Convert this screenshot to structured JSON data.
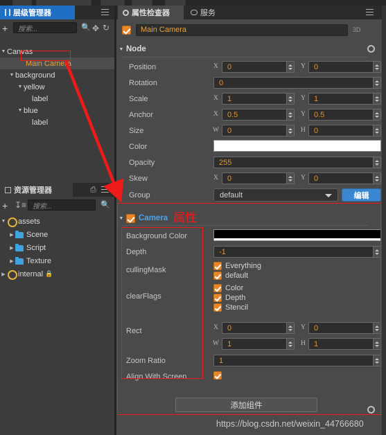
{
  "window": {
    "bg_color": "#2b2b2b",
    "accent_orange": "#e8912a",
    "accent_blue": "#3a87cf",
    "annotation_red": "#ee1b1b"
  },
  "hierarchy_panel": {
    "tab_label": "层级管理器",
    "tab_icon": "hierarchy-icon",
    "menu_icon": "hamburger-icon",
    "toolbar": {
      "add_icon": "plus-icon",
      "search_placeholder": "搜索...",
      "search_value": "",
      "icons": [
        "search-icon",
        "locate-icon",
        "refresh-icon"
      ]
    },
    "tree": [
      {
        "label": "Canvas",
        "depth": 1,
        "caret": "down",
        "selected": false,
        "color": "white"
      },
      {
        "label": "Main Camera",
        "depth": 2,
        "caret": "none",
        "selected": true,
        "color": "sel"
      },
      {
        "label": "background",
        "depth": 2,
        "caret": "down",
        "selected": false,
        "color": "white"
      },
      {
        "label": "yellow",
        "depth": 3,
        "caret": "down",
        "selected": false,
        "color": "white"
      },
      {
        "label": "label",
        "depth": 4,
        "caret": "none",
        "selected": false,
        "color": "white"
      },
      {
        "label": "blue",
        "depth": 3,
        "caret": "down",
        "selected": false,
        "color": "white"
      },
      {
        "label": "label",
        "depth": 4,
        "caret": "none",
        "selected": false,
        "color": "white"
      }
    ]
  },
  "assets_panel": {
    "tab_label": "资源管理器",
    "tab_icon": "assets-icon",
    "refresh_icon": "refresh-icon",
    "menu_icon": "hamburger-icon",
    "toolbar": {
      "add_icon": "plus-icon",
      "sort_icon": "sort-icon",
      "search_placeholder": "搜索...",
      "search_value": "",
      "search_icon": "search-icon"
    },
    "tree": [
      {
        "label": "assets",
        "depth": 1,
        "caret": "down",
        "icon": "database-icon",
        "locked": false,
        "color": "white"
      },
      {
        "label": "Scene",
        "depth": 2,
        "caret": "right",
        "icon": "folder-icon",
        "locked": false,
        "color": "white"
      },
      {
        "label": "Script",
        "depth": 2,
        "caret": "right",
        "icon": "folder-icon",
        "locked": false,
        "color": "white"
      },
      {
        "label": "Texture",
        "depth": 2,
        "caret": "right",
        "icon": "folder-icon",
        "locked": false,
        "color": "white"
      },
      {
        "label": "internal",
        "depth": 1,
        "caret": "right",
        "icon": "database-icon",
        "locked": true,
        "color": "white"
      }
    ]
  },
  "inspector": {
    "tabs": [
      {
        "label": "属性检查器",
        "icon": "gear-icon",
        "active": true
      },
      {
        "label": "服务",
        "icon": "cloud-icon",
        "active": false
      }
    ],
    "menu_icon": "hamburger-icon",
    "node_name": "Main Camera",
    "node_enabled": true,
    "mode_badge": "3D",
    "node_section": {
      "title": "Node",
      "expanded": true,
      "settings_icon": "gear-icon",
      "rows": [
        {
          "label": "Position",
          "kind": "xy",
          "x_axis": "X",
          "x": "0",
          "y_axis": "Y",
          "y": "0"
        },
        {
          "label": "Rotation",
          "kind": "single",
          "value": "0"
        },
        {
          "label": "Scale",
          "kind": "xy",
          "x_axis": "X",
          "x": "1",
          "y_axis": "Y",
          "y": "1"
        },
        {
          "label": "Anchor",
          "kind": "xy",
          "x_axis": "X",
          "x": "0.5",
          "y_axis": "Y",
          "y": "0.5"
        },
        {
          "label": "Size",
          "kind": "xy",
          "x_axis": "W",
          "x": "0",
          "y_axis": "H",
          "y": "0"
        },
        {
          "label": "Color",
          "kind": "color",
          "color": "#ffffff",
          "alpha_color": "#ffffff"
        },
        {
          "label": "Opacity",
          "kind": "single",
          "value": "255"
        },
        {
          "label": "Skew",
          "kind": "xy",
          "x_axis": "X",
          "x": "0",
          "y_axis": "Y",
          "y": "0"
        },
        {
          "label": "Group",
          "kind": "dropdown",
          "value": "default",
          "button": "编辑"
        }
      ]
    },
    "camera_section": {
      "title": "Camera",
      "enabled": true,
      "expanded": true,
      "settings_icon": "gear-icon",
      "background_color_label": "Background Color",
      "background_color": "#000000",
      "background_alpha_color": "#ffffff",
      "depth_label": "Depth",
      "depth_value": "-1",
      "culling_mask_label": "cullingMask",
      "culling_mask_items": [
        {
          "label": "Everything",
          "checked": true
        },
        {
          "label": "default",
          "checked": true
        }
      ],
      "clear_flags_label": "clearFlags",
      "clear_flags_items": [
        {
          "label": "Color",
          "checked": true
        },
        {
          "label": "Depth",
          "checked": true
        },
        {
          "label": "Stencil",
          "checked": true
        }
      ],
      "rect_label": "Rect",
      "rect": {
        "x_axis": "X",
        "x": "0",
        "y_axis": "Y",
        "y": "0",
        "w_axis": "W",
        "w": "1",
        "h_axis": "H",
        "h": "1"
      },
      "zoom_ratio_label": "Zoom Ratio",
      "zoom_ratio_value": "1",
      "align_label": "Align With Screen",
      "align_checked": true,
      "add_component_button": "添加组件"
    }
  },
  "annotations": {
    "attribute_text": "属性",
    "arrow_icon": "red-arrow",
    "highlight_main_camera": true,
    "highlight_camera_props": true
  },
  "watermark": "https://blog.csdn.net/weixin_44766680"
}
